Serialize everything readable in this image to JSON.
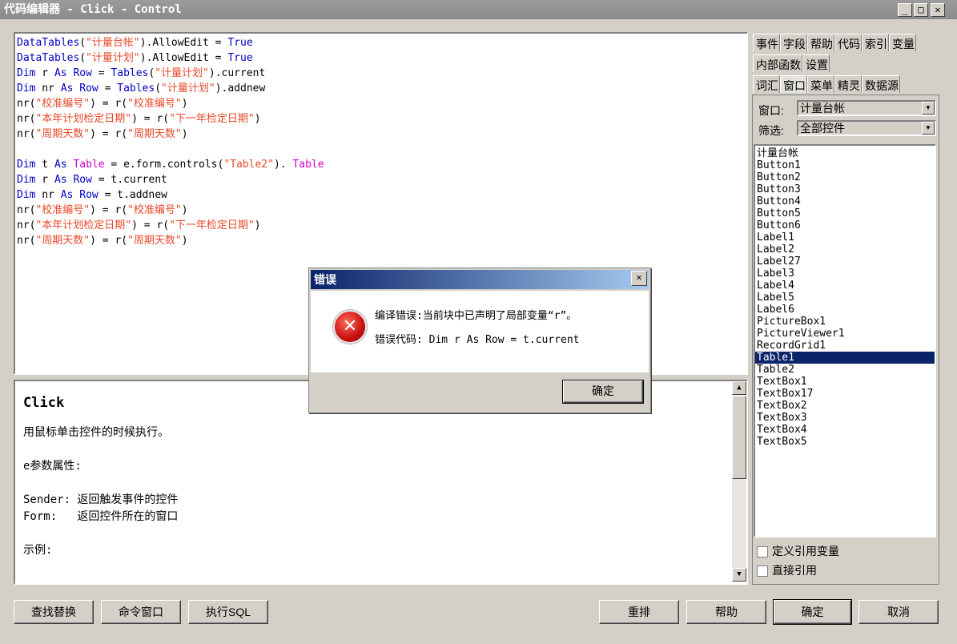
{
  "window": {
    "title": "代码编辑器 - Click - Control",
    "minimize": "_",
    "maximize": "□",
    "close": "✕"
  },
  "code_lines": [
    [
      [
        "kw",
        "DataTables"
      ],
      [
        "",
        "("
      ],
      [
        "str",
        "\"计量台帐\""
      ],
      [
        "",
        ").AllowEdit = "
      ],
      [
        "kw",
        "True"
      ]
    ],
    [
      [
        "kw",
        "DataTables"
      ],
      [
        "",
        "("
      ],
      [
        "str",
        "\"计量计划\""
      ],
      [
        "",
        ").AllowEdit = "
      ],
      [
        "kw",
        "True"
      ]
    ],
    [
      [
        "kw",
        "Dim"
      ],
      [
        "",
        " r "
      ],
      [
        "kw",
        "As"
      ],
      [
        "",
        " "
      ],
      [
        "kw",
        "Row"
      ],
      [
        "",
        " = "
      ],
      [
        "kw",
        "Tables"
      ],
      [
        "",
        "("
      ],
      [
        "str",
        "\"计量计划\""
      ],
      [
        "",
        ").current"
      ]
    ],
    [
      [
        "kw",
        "Dim"
      ],
      [
        "",
        " nr "
      ],
      [
        "kw",
        "As"
      ],
      [
        "",
        " "
      ],
      [
        "kw",
        "Row"
      ],
      [
        "",
        " = "
      ],
      [
        "kw",
        "Tables"
      ],
      [
        "",
        "("
      ],
      [
        "str",
        "\"计量计划\""
      ],
      [
        "",
        ").addnew"
      ]
    ],
    [
      [
        "",
        "nr("
      ],
      [
        "str",
        "\"校准编号\""
      ],
      [
        "",
        ") = r("
      ],
      [
        "str",
        "\"校准编号\""
      ],
      [
        "",
        ")"
      ]
    ],
    [
      [
        "",
        "nr("
      ],
      [
        "str",
        "\"本年计划检定日期\""
      ],
      [
        "",
        ") = r("
      ],
      [
        "str",
        "\"下一年检定日期\""
      ],
      [
        "",
        ")"
      ]
    ],
    [
      [
        "",
        "nr("
      ],
      [
        "str",
        "\"周期天数\""
      ],
      [
        "",
        ") = r("
      ],
      [
        "str",
        "\"周期天数\""
      ],
      [
        "",
        ")"
      ]
    ],
    [],
    [
      [
        "kw",
        "Dim"
      ],
      [
        "",
        " t "
      ],
      [
        "kw",
        "As"
      ],
      [
        "",
        " "
      ],
      [
        "typ",
        "Table"
      ],
      [
        "",
        " = e.form.controls("
      ],
      [
        "str",
        "\"Table2\""
      ],
      [
        "",
        "). "
      ],
      [
        "typ",
        "Table"
      ]
    ],
    [
      [
        "kw",
        "Dim"
      ],
      [
        "",
        " r "
      ],
      [
        "kw",
        "As"
      ],
      [
        "",
        " "
      ],
      [
        "kw",
        "Row"
      ],
      [
        "",
        " = t.current"
      ]
    ],
    [
      [
        "kw",
        "Dim"
      ],
      [
        "",
        " nr "
      ],
      [
        "kw",
        "As"
      ],
      [
        "",
        " "
      ],
      [
        "kw",
        "Row"
      ],
      [
        "",
        " = t.addnew"
      ]
    ],
    [
      [
        "",
        "nr("
      ],
      [
        "str",
        "\"校准编号\""
      ],
      [
        "",
        ") = r("
      ],
      [
        "str",
        "\"校准编号\""
      ],
      [
        "",
        ")"
      ]
    ],
    [
      [
        "",
        "nr("
      ],
      [
        "str",
        "\"本年计划检定日期\""
      ],
      [
        "",
        ") = r("
      ],
      [
        "str",
        "\"下一年检定日期\""
      ],
      [
        "",
        ")"
      ]
    ],
    [
      [
        "",
        "nr("
      ],
      [
        "str",
        "\"周期天数\""
      ],
      [
        "",
        ") = r("
      ],
      [
        "str",
        "\"周期天数\""
      ],
      [
        "",
        ")"
      ]
    ]
  ],
  "help": {
    "heading": "Click",
    "desc": "用鼠标单击控件的时候执行。",
    "params_title": "e参数属性:",
    "sender": "Sender: 返回触发事件的控件",
    "form": "Form:   返回控件所在的窗口",
    "example_title": "示例:"
  },
  "tabs": {
    "row1": [
      "事件",
      "字段",
      "帮助",
      "代码",
      "索引",
      "变量"
    ],
    "row2": [
      "内部函数",
      "设置"
    ],
    "row3": [
      "词汇",
      "窗口",
      "菜单",
      "精灵",
      "数据源"
    ],
    "active": "窗口"
  },
  "window_selector": {
    "label": "窗口:",
    "value": "计量台帐"
  },
  "filter_selector": {
    "label": "筛选:",
    "value": "全部控件"
  },
  "controls": [
    "计量台帐",
    "Button1",
    "Button2",
    "Button3",
    "Button4",
    "Button5",
    "Button6",
    "Label1",
    "Label2",
    "Label27",
    "Label3",
    "Label4",
    "Label5",
    "Label6",
    "PictureBox1",
    "PictureViewer1",
    "RecordGrid1",
    "Table1",
    "Table2",
    "TextBox1",
    "TextBox17",
    "TextBox2",
    "TextBox3",
    "TextBox4",
    "TextBox5"
  ],
  "selected_control": "Table1",
  "checkboxes": {
    "define_ref_var": "定义引用变量",
    "direct_ref": "直接引用"
  },
  "buttons": {
    "find_replace": "查找替换",
    "command_window": "命令窗口",
    "exec_sql": "执行SQL",
    "rearrange": "重排",
    "help": "帮助",
    "ok": "确定",
    "cancel": "取消"
  },
  "dialog": {
    "title": "错误",
    "close": "✕",
    "icon": "✕",
    "message": "编译错误:当前块中已声明了局部变量“r”。",
    "code": "错误代码: Dim r As Row = t.current",
    "ok": "确定"
  }
}
